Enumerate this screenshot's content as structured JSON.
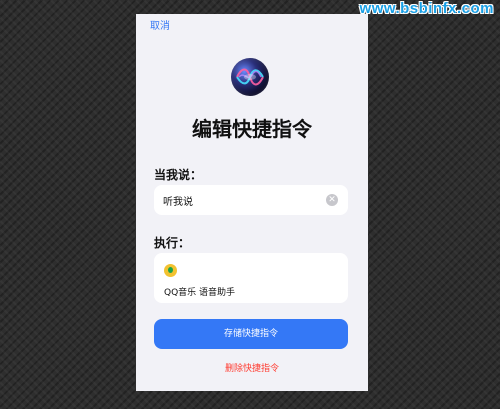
{
  "watermark": "www.bsbinfx.com",
  "header": {
    "cancel_label": "取消"
  },
  "title": "编辑快捷指令",
  "trigger": {
    "label": "当我说：",
    "phrase": "听我说"
  },
  "action": {
    "label": "执行：",
    "app_name": "QQ音乐 语音助手",
    "icon": "qq-music-icon"
  },
  "buttons": {
    "save_label": "存储快捷指令",
    "delete_label": "删除快捷指令"
  },
  "colors": {
    "accent": "#3478f6",
    "destructive": "#ff3b30",
    "background": "#f2f2f7"
  }
}
